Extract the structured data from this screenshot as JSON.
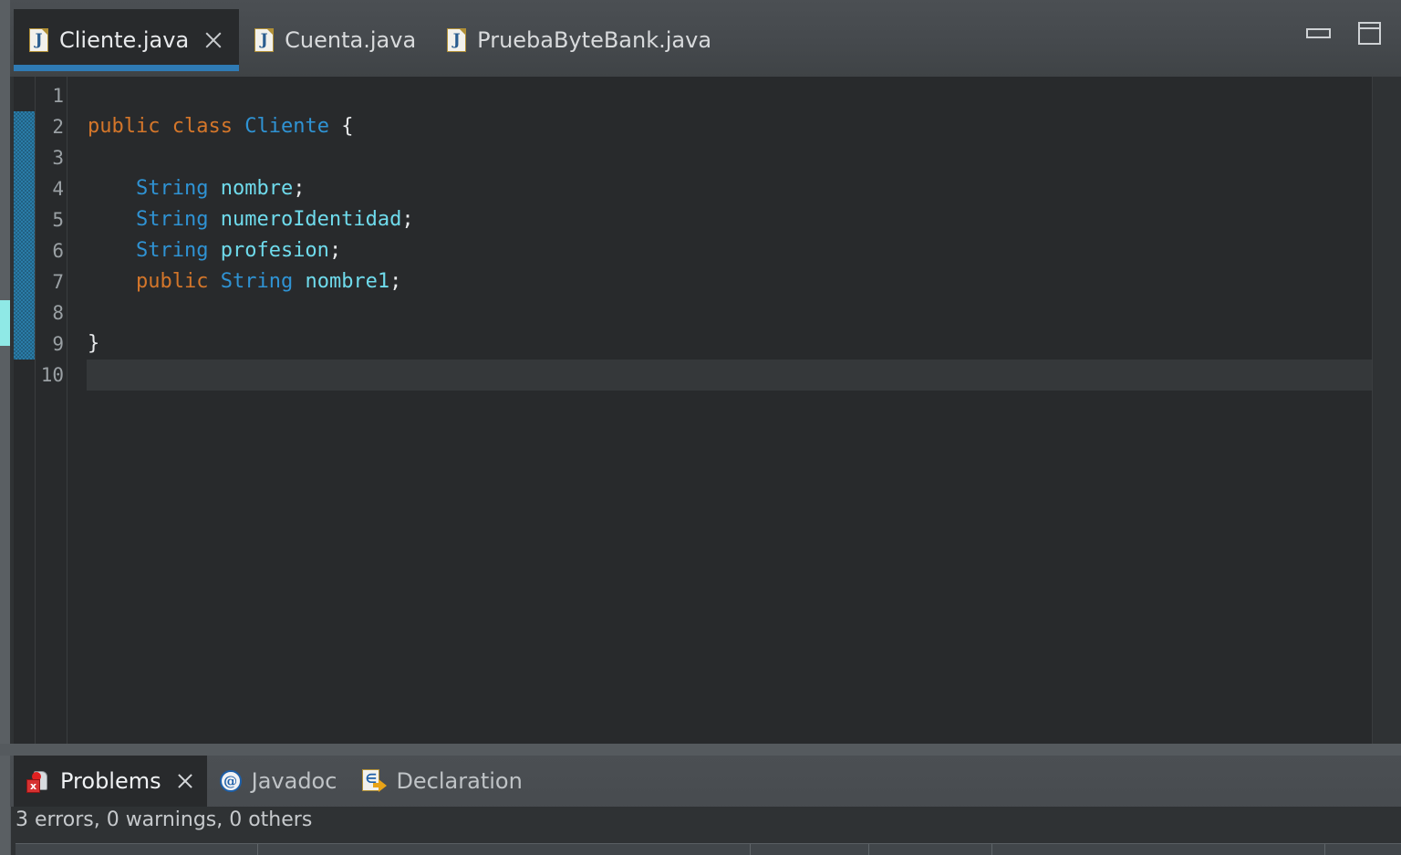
{
  "window": {
    "minimize_label": "Minimize",
    "maximize_label": "Maximize"
  },
  "editor": {
    "tabs": [
      {
        "label": "Cliente.java",
        "icon": "java-file-icon",
        "active": true,
        "closable": true
      },
      {
        "label": "Cuenta.java",
        "icon": "java-file-icon",
        "active": false,
        "closable": false
      },
      {
        "label": "PruebaByteBank.java",
        "icon": "java-file-icon",
        "active": false,
        "closable": false
      }
    ],
    "active_file": "Cliente.java",
    "language": "Java",
    "line_numbers": [
      "1",
      "2",
      "3",
      "4",
      "5",
      "6",
      "7",
      "8",
      "9",
      "10"
    ],
    "current_line": 10,
    "change_bar_lines": [
      2,
      9
    ],
    "lines": [
      {
        "num": 1,
        "tokens": []
      },
      {
        "num": 2,
        "tokens": [
          {
            "text": "public",
            "type": "kw"
          },
          {
            "text": " ",
            "type": "plain"
          },
          {
            "text": "class",
            "type": "kw"
          },
          {
            "text": " ",
            "type": "plain"
          },
          {
            "text": "Cliente",
            "type": "type"
          },
          {
            "text": " ",
            "type": "plain"
          },
          {
            "text": "{",
            "type": "punc"
          }
        ]
      },
      {
        "num": 3,
        "tokens": []
      },
      {
        "num": 4,
        "tokens": [
          {
            "text": "    ",
            "type": "plain"
          },
          {
            "text": "String",
            "type": "type"
          },
          {
            "text": " ",
            "type": "plain"
          },
          {
            "text": "nombre",
            "type": "var"
          },
          {
            "text": ";",
            "type": "punc"
          }
        ]
      },
      {
        "num": 5,
        "tokens": [
          {
            "text": "    ",
            "type": "plain"
          },
          {
            "text": "String",
            "type": "type"
          },
          {
            "text": " ",
            "type": "plain"
          },
          {
            "text": "numeroIdentidad",
            "type": "var"
          },
          {
            "text": ";",
            "type": "punc"
          }
        ]
      },
      {
        "num": 6,
        "tokens": [
          {
            "text": "    ",
            "type": "plain"
          },
          {
            "text": "String",
            "type": "type"
          },
          {
            "text": " ",
            "type": "plain"
          },
          {
            "text": "profesion",
            "type": "var"
          },
          {
            "text": ";",
            "type": "punc"
          }
        ]
      },
      {
        "num": 7,
        "tokens": [
          {
            "text": "    ",
            "type": "plain"
          },
          {
            "text": "public",
            "type": "kw"
          },
          {
            "text": " ",
            "type": "plain"
          },
          {
            "text": "String",
            "type": "type"
          },
          {
            "text": " ",
            "type": "plain"
          },
          {
            "text": "nombre1",
            "type": "var"
          },
          {
            "text": ";",
            "type": "punc"
          }
        ]
      },
      {
        "num": 8,
        "tokens": []
      },
      {
        "num": 9,
        "tokens": [
          {
            "text": "}",
            "type": "punc"
          }
        ]
      },
      {
        "num": 10,
        "tokens": []
      }
    ]
  },
  "bottom_panel": {
    "tabs": [
      {
        "label": "Problems",
        "icon": "problems-icon",
        "active": true,
        "closable": true
      },
      {
        "label": "Javadoc",
        "icon": "javadoc-icon",
        "active": false,
        "closable": false
      },
      {
        "label": "Declaration",
        "icon": "declaration-icon",
        "active": false,
        "closable": false
      }
    ],
    "problems_summary": "3 errors, 0 warnings, 0 others",
    "error_count": 3,
    "warning_count": 0,
    "other_count": 0
  },
  "colors": {
    "keyword": "#d4762a",
    "type": "#2f93d4",
    "variable": "#6fdbec",
    "plain": "#e9ebed",
    "editor_bg": "#282a2c",
    "chrome_bg": "#45494d",
    "accent": "#2f7bb5",
    "change_bar": "#2a7ca8",
    "marker": "#8fe9e6"
  }
}
